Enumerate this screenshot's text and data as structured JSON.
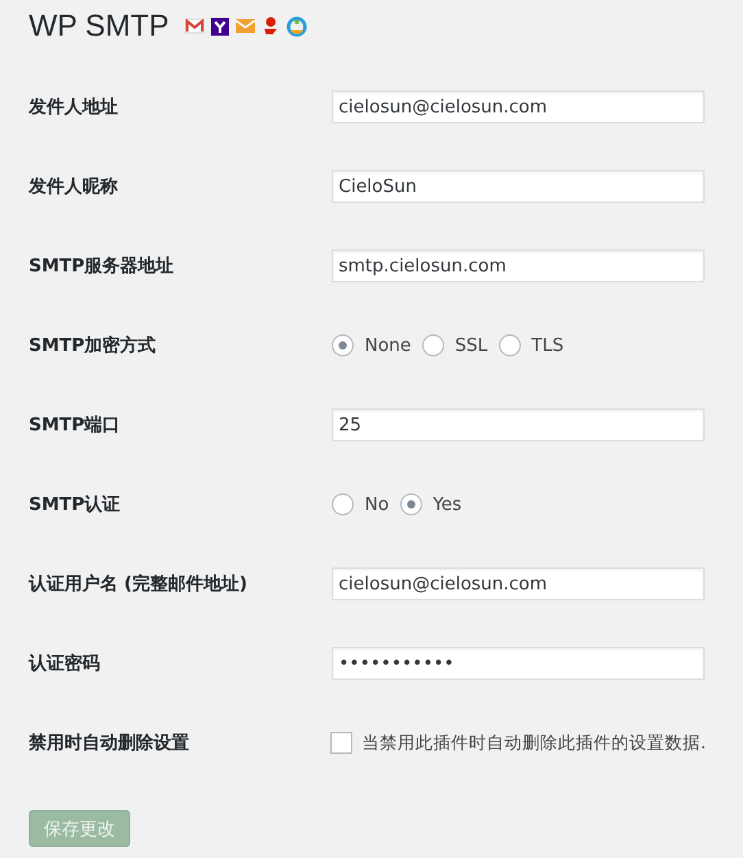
{
  "title": "WP SMTP",
  "provider_icons": [
    {
      "kind": "gmail"
    },
    {
      "kind": "yahoo"
    },
    {
      "kind": "envelope"
    },
    {
      "kind": "netease"
    },
    {
      "kind": "ring"
    }
  ],
  "fields": [
    {
      "kind": "text",
      "label": "发件人地址",
      "value": "cielosun@cielosun.com"
    },
    {
      "kind": "text",
      "label": "发件人昵称",
      "value": "CieloSun"
    },
    {
      "kind": "text",
      "label": "SMTP服务器地址",
      "value": "smtp.cielosun.com"
    },
    {
      "kind": "radio",
      "label": "SMTP加密方式",
      "options": [
        {
          "label": "None",
          "selected": true
        },
        {
          "label": "SSL",
          "selected": false
        },
        {
          "label": "TLS",
          "selected": false
        }
      ]
    },
    {
      "kind": "text",
      "label": "SMTP端口",
      "value": "25"
    },
    {
      "kind": "radio",
      "label": "SMTP认证",
      "options": [
        {
          "label": "No",
          "selected": false
        },
        {
          "label": "Yes",
          "selected": true
        }
      ]
    },
    {
      "kind": "text",
      "label": "认证用户名 (完整邮件地址)",
      "value": "cielosun@cielosun.com"
    },
    {
      "kind": "password",
      "label": "认证密码",
      "value": "•••••••••••"
    },
    {
      "kind": "checkbox",
      "label": "禁用时自动删除设置",
      "text": "当禁用此插件时自动删除此插件的设置数据.",
      "checked": false
    }
  ],
  "save_button": "保存更改"
}
